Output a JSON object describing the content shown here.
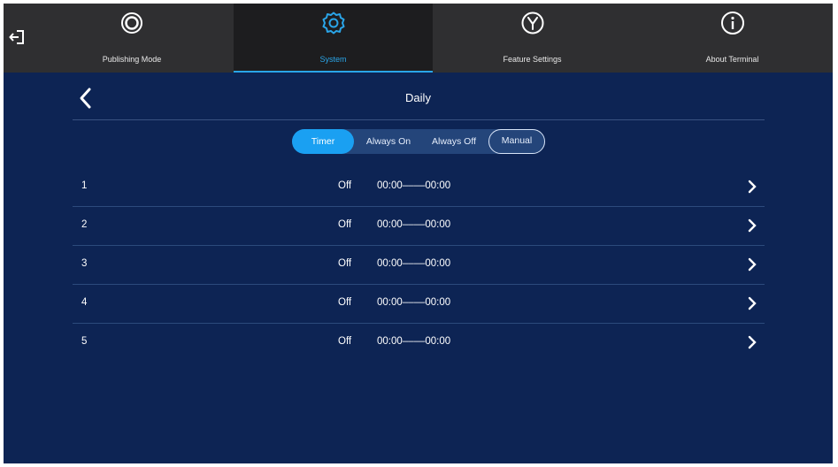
{
  "nav": {
    "tabs": [
      {
        "label": "Publishing Mode",
        "icon": "target-ring-icon"
      },
      {
        "label": "System",
        "icon": "gear-icon",
        "active": true
      },
      {
        "label": "Feature Settings",
        "icon": "y-circle-icon"
      },
      {
        "label": "About Terminal",
        "icon": "info-icon"
      }
    ]
  },
  "page": {
    "title": "Daily"
  },
  "modes": {
    "items": [
      "Timer",
      "Always On",
      "Always Off",
      "Manual"
    ],
    "selected": "Timer"
  },
  "schedule": {
    "rows": [
      {
        "num": "1",
        "status": "Off",
        "time": "00:00––––00:00"
      },
      {
        "num": "2",
        "status": "Off",
        "time": "00:00––––00:00"
      },
      {
        "num": "3",
        "status": "Off",
        "time": "00:00––––00:00"
      },
      {
        "num": "4",
        "status": "Off",
        "time": "00:00––––00:00"
      },
      {
        "num": "5",
        "status": "Off",
        "time": "00:00––––00:00"
      }
    ]
  },
  "colors": {
    "accent": "#1aa0f2",
    "background": "#0d2454",
    "navbar": "#2f2f31"
  }
}
